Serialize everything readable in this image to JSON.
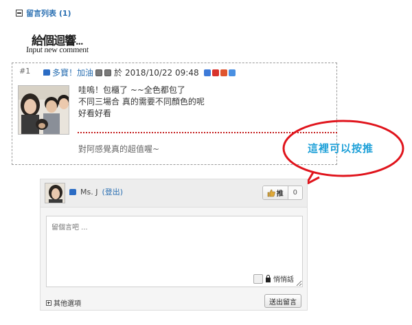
{
  "list": {
    "title": "留言列表 (1)"
  },
  "logo": {
    "cn_main": "給個迴響",
    "cn_dots": "...",
    "en": "Input new comment"
  },
  "comment": {
    "index": "#1",
    "author": "多寶！加油",
    "date_prefix": "於",
    "date": "2018/10/22 09:48",
    "body": [
      "哇嗚！包櫃了 ~~全色都包了",
      "不同三場合 真的需要不同顏色的呢",
      "好看好看"
    ],
    "reply": "對阿感覺真的超值喔~"
  },
  "annotation": {
    "label": "這裡可以按推",
    "color": "#e0141c"
  },
  "reply_box": {
    "user_name": "Ms. J",
    "logout_label": "(登出)",
    "like_label": "推",
    "like_count": "0",
    "placeholder": "留個言吧 ...",
    "private_label": "悄悄話",
    "other_options_label": "其他選項",
    "submit_label": "送出留言"
  },
  "colors": {
    "link": "#2a6fb2",
    "accent_dots": "#c41b1b",
    "bubble_text": "#1da0d8"
  }
}
